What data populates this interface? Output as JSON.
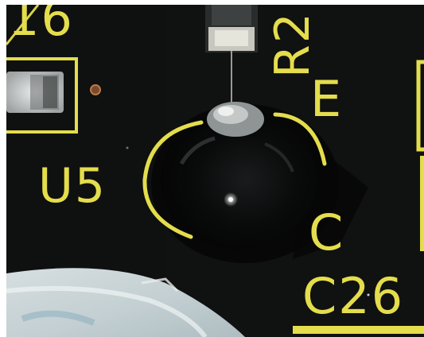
{
  "photo": {
    "board_color": "#0e0f0f",
    "silkscreen_color": "#e4dd4c",
    "labels": {
      "top_left": "16",
      "resistor": "R2",
      "component": "U5",
      "emitter": "E",
      "collector": "C",
      "capacitor": "C26"
    }
  }
}
